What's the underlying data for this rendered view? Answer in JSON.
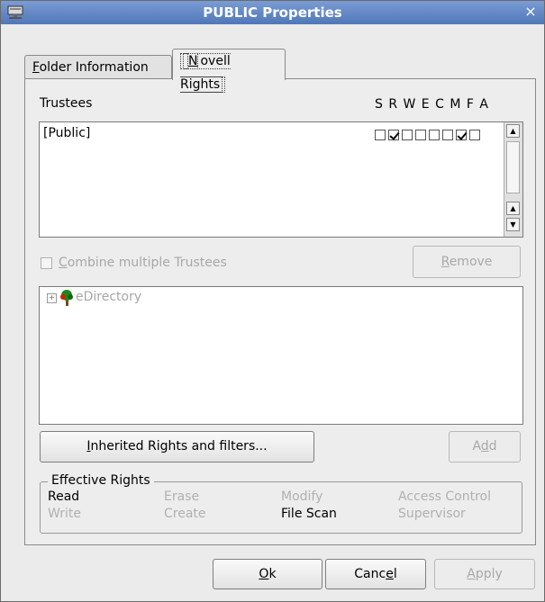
{
  "window": {
    "title": "PUBLIC Properties",
    "close_glyph": "×"
  },
  "tabs": [
    {
      "pre": "",
      "key": "F",
      "post": "older Information"
    },
    {
      "pre": "",
      "key": "N",
      "post": "ovell Rights"
    }
  ],
  "trustees": {
    "heading": "Trustees",
    "rights_header": "S R W E C M F A",
    "rows": [
      {
        "name": "[Public]",
        "rights": [
          false,
          true,
          false,
          false,
          false,
          false,
          true,
          false
        ]
      }
    ]
  },
  "combine": {
    "pre": "",
    "key": "C",
    "post": "ombine multiple Trustees",
    "checked": false
  },
  "remove_button": {
    "pre": "",
    "key": "R",
    "post": "emove"
  },
  "tree": {
    "root_label": "eDirectory",
    "expander": "+"
  },
  "inherited_button": {
    "pre": "",
    "key": "I",
    "post": "nherited Rights and filters..."
  },
  "add_button": {
    "pre": "A",
    "key": "d",
    "post": "d"
  },
  "effective_rights": {
    "title": "Effective Rights",
    "items": [
      {
        "label": "Read",
        "active": true
      },
      {
        "label": "Erase",
        "active": false
      },
      {
        "label": "Modify",
        "active": false
      },
      {
        "label": "Access Control",
        "active": false
      },
      {
        "label": "Write",
        "active": false
      },
      {
        "label": "Create",
        "active": false
      },
      {
        "label": "File Scan",
        "active": true
      },
      {
        "label": "Supervisor",
        "active": false
      }
    ]
  },
  "footer": {
    "ok": {
      "pre": "",
      "key": "O",
      "post": "k"
    },
    "cancel": {
      "pre": "Canc",
      "key": "e",
      "post": "l"
    },
    "apply": {
      "pre": "",
      "key": "A",
      "post": "pply"
    }
  },
  "colors": {
    "titlebar": "#5a80c0",
    "disabled_text": "#a8a8a8"
  }
}
